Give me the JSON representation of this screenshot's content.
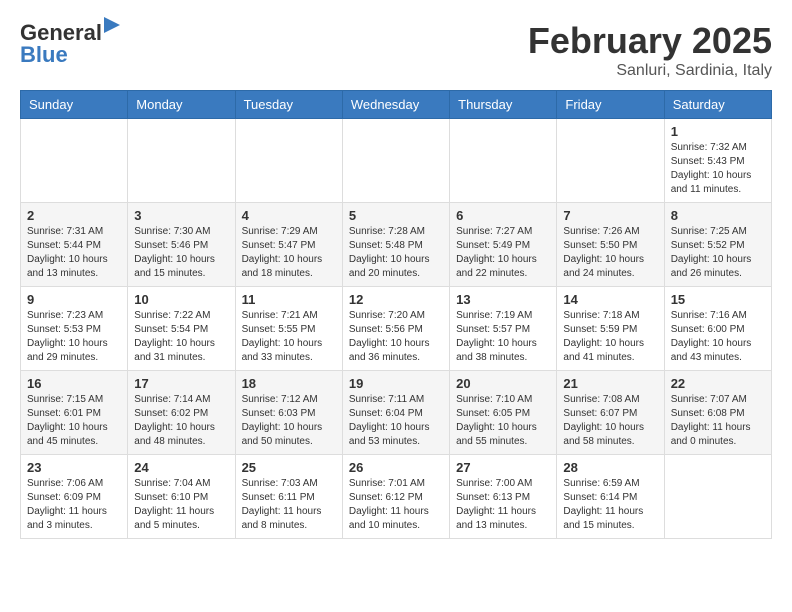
{
  "header": {
    "logo_line1": "General",
    "logo_line2": "Blue",
    "title": "February 2025",
    "subtitle": "Sanluri, Sardinia, Italy"
  },
  "weekdays": [
    "Sunday",
    "Monday",
    "Tuesday",
    "Wednesday",
    "Thursday",
    "Friday",
    "Saturday"
  ],
  "weeks": [
    [
      {
        "day": "",
        "info": ""
      },
      {
        "day": "",
        "info": ""
      },
      {
        "day": "",
        "info": ""
      },
      {
        "day": "",
        "info": ""
      },
      {
        "day": "",
        "info": ""
      },
      {
        "day": "",
        "info": ""
      },
      {
        "day": "1",
        "info": "Sunrise: 7:32 AM\nSunset: 5:43 PM\nDaylight: 10 hours and 11 minutes."
      }
    ],
    [
      {
        "day": "2",
        "info": "Sunrise: 7:31 AM\nSunset: 5:44 PM\nDaylight: 10 hours and 13 minutes."
      },
      {
        "day": "3",
        "info": "Sunrise: 7:30 AM\nSunset: 5:46 PM\nDaylight: 10 hours and 15 minutes."
      },
      {
        "day": "4",
        "info": "Sunrise: 7:29 AM\nSunset: 5:47 PM\nDaylight: 10 hours and 18 minutes."
      },
      {
        "day": "5",
        "info": "Sunrise: 7:28 AM\nSunset: 5:48 PM\nDaylight: 10 hours and 20 minutes."
      },
      {
        "day": "6",
        "info": "Sunrise: 7:27 AM\nSunset: 5:49 PM\nDaylight: 10 hours and 22 minutes."
      },
      {
        "day": "7",
        "info": "Sunrise: 7:26 AM\nSunset: 5:50 PM\nDaylight: 10 hours and 24 minutes."
      },
      {
        "day": "8",
        "info": "Sunrise: 7:25 AM\nSunset: 5:52 PM\nDaylight: 10 hours and 26 minutes."
      }
    ],
    [
      {
        "day": "9",
        "info": "Sunrise: 7:23 AM\nSunset: 5:53 PM\nDaylight: 10 hours and 29 minutes."
      },
      {
        "day": "10",
        "info": "Sunrise: 7:22 AM\nSunset: 5:54 PM\nDaylight: 10 hours and 31 minutes."
      },
      {
        "day": "11",
        "info": "Sunrise: 7:21 AM\nSunset: 5:55 PM\nDaylight: 10 hours and 33 minutes."
      },
      {
        "day": "12",
        "info": "Sunrise: 7:20 AM\nSunset: 5:56 PM\nDaylight: 10 hours and 36 minutes."
      },
      {
        "day": "13",
        "info": "Sunrise: 7:19 AM\nSunset: 5:57 PM\nDaylight: 10 hours and 38 minutes."
      },
      {
        "day": "14",
        "info": "Sunrise: 7:18 AM\nSunset: 5:59 PM\nDaylight: 10 hours and 41 minutes."
      },
      {
        "day": "15",
        "info": "Sunrise: 7:16 AM\nSunset: 6:00 PM\nDaylight: 10 hours and 43 minutes."
      }
    ],
    [
      {
        "day": "16",
        "info": "Sunrise: 7:15 AM\nSunset: 6:01 PM\nDaylight: 10 hours and 45 minutes."
      },
      {
        "day": "17",
        "info": "Sunrise: 7:14 AM\nSunset: 6:02 PM\nDaylight: 10 hours and 48 minutes."
      },
      {
        "day": "18",
        "info": "Sunrise: 7:12 AM\nSunset: 6:03 PM\nDaylight: 10 hours and 50 minutes."
      },
      {
        "day": "19",
        "info": "Sunrise: 7:11 AM\nSunset: 6:04 PM\nDaylight: 10 hours and 53 minutes."
      },
      {
        "day": "20",
        "info": "Sunrise: 7:10 AM\nSunset: 6:05 PM\nDaylight: 10 hours and 55 minutes."
      },
      {
        "day": "21",
        "info": "Sunrise: 7:08 AM\nSunset: 6:07 PM\nDaylight: 10 hours and 58 minutes."
      },
      {
        "day": "22",
        "info": "Sunrise: 7:07 AM\nSunset: 6:08 PM\nDaylight: 11 hours and 0 minutes."
      }
    ],
    [
      {
        "day": "23",
        "info": "Sunrise: 7:06 AM\nSunset: 6:09 PM\nDaylight: 11 hours and 3 minutes."
      },
      {
        "day": "24",
        "info": "Sunrise: 7:04 AM\nSunset: 6:10 PM\nDaylight: 11 hours and 5 minutes."
      },
      {
        "day": "25",
        "info": "Sunrise: 7:03 AM\nSunset: 6:11 PM\nDaylight: 11 hours and 8 minutes."
      },
      {
        "day": "26",
        "info": "Sunrise: 7:01 AM\nSunset: 6:12 PM\nDaylight: 11 hours and 10 minutes."
      },
      {
        "day": "27",
        "info": "Sunrise: 7:00 AM\nSunset: 6:13 PM\nDaylight: 11 hours and 13 minutes."
      },
      {
        "day": "28",
        "info": "Sunrise: 6:59 AM\nSunset: 6:14 PM\nDaylight: 11 hours and 15 minutes."
      },
      {
        "day": "",
        "info": ""
      }
    ]
  ]
}
